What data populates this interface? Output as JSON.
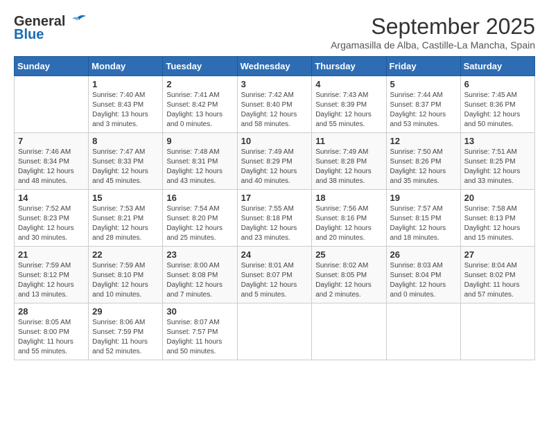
{
  "header": {
    "logo_general": "General",
    "logo_blue": "Blue",
    "month_year": "September 2025",
    "location": "Argamasilla de Alba, Castille-La Mancha, Spain"
  },
  "weekdays": [
    "Sunday",
    "Monday",
    "Tuesday",
    "Wednesday",
    "Thursday",
    "Friday",
    "Saturday"
  ],
  "weeks": [
    [
      {
        "day": "",
        "info": ""
      },
      {
        "day": "1",
        "info": "Sunrise: 7:40 AM\nSunset: 8:43 PM\nDaylight: 13 hours\nand 3 minutes."
      },
      {
        "day": "2",
        "info": "Sunrise: 7:41 AM\nSunset: 8:42 PM\nDaylight: 13 hours\nand 0 minutes."
      },
      {
        "day": "3",
        "info": "Sunrise: 7:42 AM\nSunset: 8:40 PM\nDaylight: 12 hours\nand 58 minutes."
      },
      {
        "day": "4",
        "info": "Sunrise: 7:43 AM\nSunset: 8:39 PM\nDaylight: 12 hours\nand 55 minutes."
      },
      {
        "day": "5",
        "info": "Sunrise: 7:44 AM\nSunset: 8:37 PM\nDaylight: 12 hours\nand 53 minutes."
      },
      {
        "day": "6",
        "info": "Sunrise: 7:45 AM\nSunset: 8:36 PM\nDaylight: 12 hours\nand 50 minutes."
      }
    ],
    [
      {
        "day": "7",
        "info": "Sunrise: 7:46 AM\nSunset: 8:34 PM\nDaylight: 12 hours\nand 48 minutes."
      },
      {
        "day": "8",
        "info": "Sunrise: 7:47 AM\nSunset: 8:33 PM\nDaylight: 12 hours\nand 45 minutes."
      },
      {
        "day": "9",
        "info": "Sunrise: 7:48 AM\nSunset: 8:31 PM\nDaylight: 12 hours\nand 43 minutes."
      },
      {
        "day": "10",
        "info": "Sunrise: 7:49 AM\nSunset: 8:29 PM\nDaylight: 12 hours\nand 40 minutes."
      },
      {
        "day": "11",
        "info": "Sunrise: 7:49 AM\nSunset: 8:28 PM\nDaylight: 12 hours\nand 38 minutes."
      },
      {
        "day": "12",
        "info": "Sunrise: 7:50 AM\nSunset: 8:26 PM\nDaylight: 12 hours\nand 35 minutes."
      },
      {
        "day": "13",
        "info": "Sunrise: 7:51 AM\nSunset: 8:25 PM\nDaylight: 12 hours\nand 33 minutes."
      }
    ],
    [
      {
        "day": "14",
        "info": "Sunrise: 7:52 AM\nSunset: 8:23 PM\nDaylight: 12 hours\nand 30 minutes."
      },
      {
        "day": "15",
        "info": "Sunrise: 7:53 AM\nSunset: 8:21 PM\nDaylight: 12 hours\nand 28 minutes."
      },
      {
        "day": "16",
        "info": "Sunrise: 7:54 AM\nSunset: 8:20 PM\nDaylight: 12 hours\nand 25 minutes."
      },
      {
        "day": "17",
        "info": "Sunrise: 7:55 AM\nSunset: 8:18 PM\nDaylight: 12 hours\nand 23 minutes."
      },
      {
        "day": "18",
        "info": "Sunrise: 7:56 AM\nSunset: 8:16 PM\nDaylight: 12 hours\nand 20 minutes."
      },
      {
        "day": "19",
        "info": "Sunrise: 7:57 AM\nSunset: 8:15 PM\nDaylight: 12 hours\nand 18 minutes."
      },
      {
        "day": "20",
        "info": "Sunrise: 7:58 AM\nSunset: 8:13 PM\nDaylight: 12 hours\nand 15 minutes."
      }
    ],
    [
      {
        "day": "21",
        "info": "Sunrise: 7:59 AM\nSunset: 8:12 PM\nDaylight: 12 hours\nand 13 minutes."
      },
      {
        "day": "22",
        "info": "Sunrise: 7:59 AM\nSunset: 8:10 PM\nDaylight: 12 hours\nand 10 minutes."
      },
      {
        "day": "23",
        "info": "Sunrise: 8:00 AM\nSunset: 8:08 PM\nDaylight: 12 hours\nand 7 minutes."
      },
      {
        "day": "24",
        "info": "Sunrise: 8:01 AM\nSunset: 8:07 PM\nDaylight: 12 hours\nand 5 minutes."
      },
      {
        "day": "25",
        "info": "Sunrise: 8:02 AM\nSunset: 8:05 PM\nDaylight: 12 hours\nand 2 minutes."
      },
      {
        "day": "26",
        "info": "Sunrise: 8:03 AM\nSunset: 8:04 PM\nDaylight: 12 hours\nand 0 minutes."
      },
      {
        "day": "27",
        "info": "Sunrise: 8:04 AM\nSunset: 8:02 PM\nDaylight: 11 hours\nand 57 minutes."
      }
    ],
    [
      {
        "day": "28",
        "info": "Sunrise: 8:05 AM\nSunset: 8:00 PM\nDaylight: 11 hours\nand 55 minutes."
      },
      {
        "day": "29",
        "info": "Sunrise: 8:06 AM\nSunset: 7:59 PM\nDaylight: 11 hours\nand 52 minutes."
      },
      {
        "day": "30",
        "info": "Sunrise: 8:07 AM\nSunset: 7:57 PM\nDaylight: 11 hours\nand 50 minutes."
      },
      {
        "day": "",
        "info": ""
      },
      {
        "day": "",
        "info": ""
      },
      {
        "day": "",
        "info": ""
      },
      {
        "day": "",
        "info": ""
      }
    ]
  ]
}
